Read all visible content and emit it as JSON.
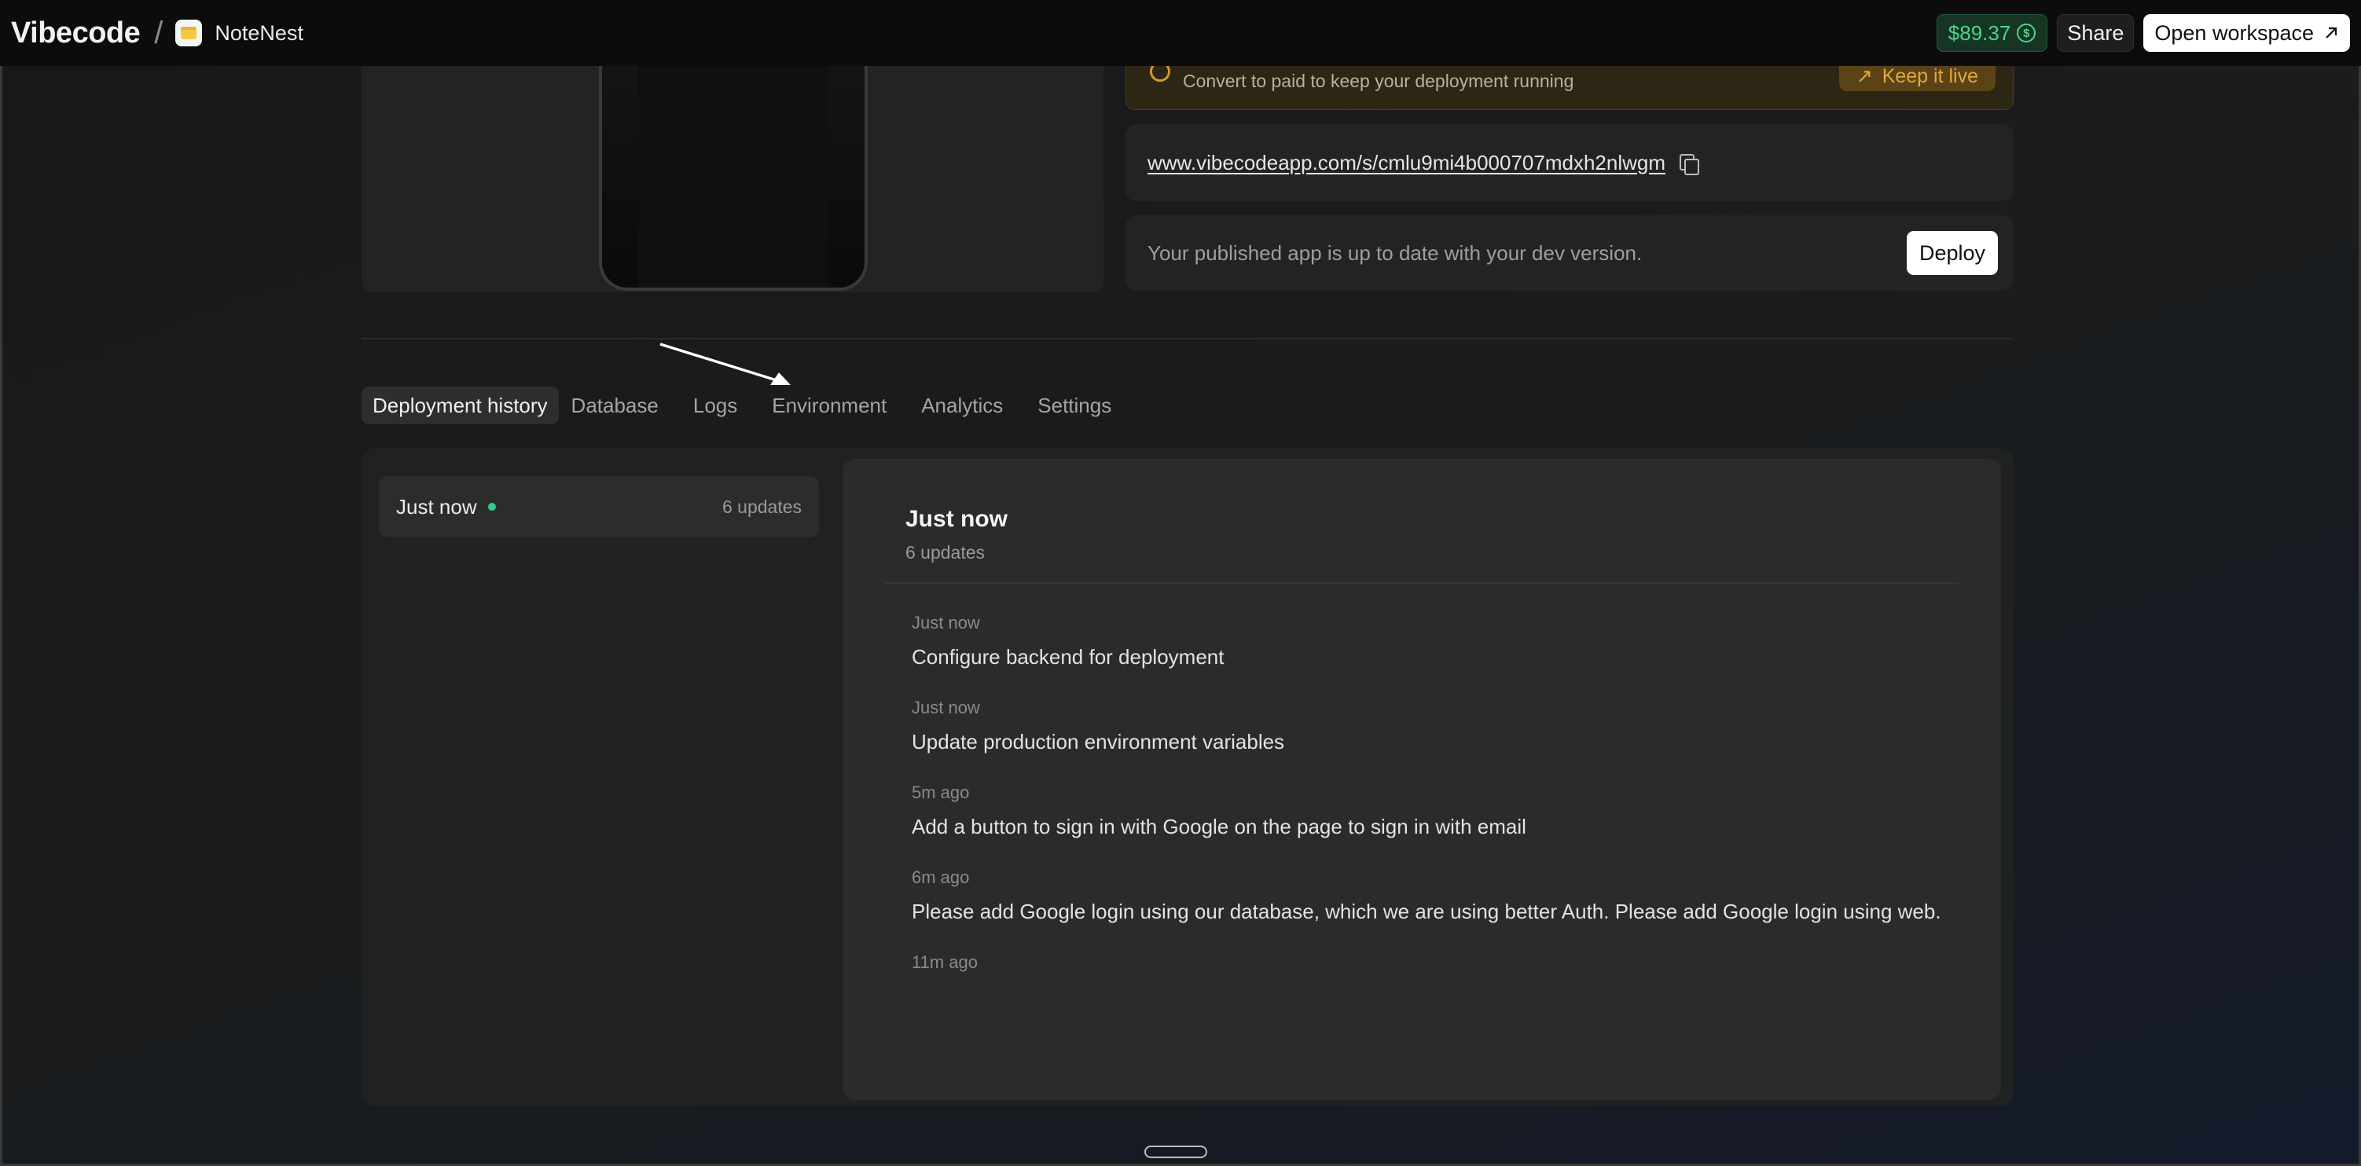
{
  "topbar": {
    "brand": "Vibecode",
    "separator": "/",
    "app_name": "NoteNest",
    "balance": "$89.37",
    "share_label": "Share",
    "open_workspace_label": "Open workspace"
  },
  "banner": {
    "message": "Convert to paid to keep your deployment running",
    "action_label": "Keep it live"
  },
  "url": {
    "text": "www.vibecodeapp.com/s/cmlu9mi4b000707mdxh2nlwgm"
  },
  "deploy": {
    "message": "Your published app is up to date with your dev version.",
    "button_label": "Deploy"
  },
  "tabs": [
    {
      "label": "Deployment history",
      "active": true
    },
    {
      "label": "Database",
      "active": false
    },
    {
      "label": "Logs",
      "active": false
    },
    {
      "label": "Environment",
      "active": false
    },
    {
      "label": "Analytics",
      "active": false
    },
    {
      "label": "Settings",
      "active": false
    }
  ],
  "history": {
    "items": [
      {
        "label": "Just now",
        "count": "6 updates"
      }
    ],
    "detail": {
      "title": "Just now",
      "subtitle": "6 updates",
      "updates": [
        {
          "time": "Just now",
          "text": "Configure backend for deployment"
        },
        {
          "time": "Just now",
          "text": "Update production environment variables"
        },
        {
          "time": "5m ago",
          "text": "Add a button to sign in with Google on the page to sign in with email"
        },
        {
          "time": "6m ago",
          "text": "Please add Google login using our database, which we are using better Auth. Please add Google login using web."
        },
        {
          "time": "11m ago",
          "text": ""
        }
      ]
    }
  },
  "colors": {
    "balance_green": "#4fd38b",
    "warning_amber": "#e3a83a",
    "status_dot": "#35c98a"
  }
}
